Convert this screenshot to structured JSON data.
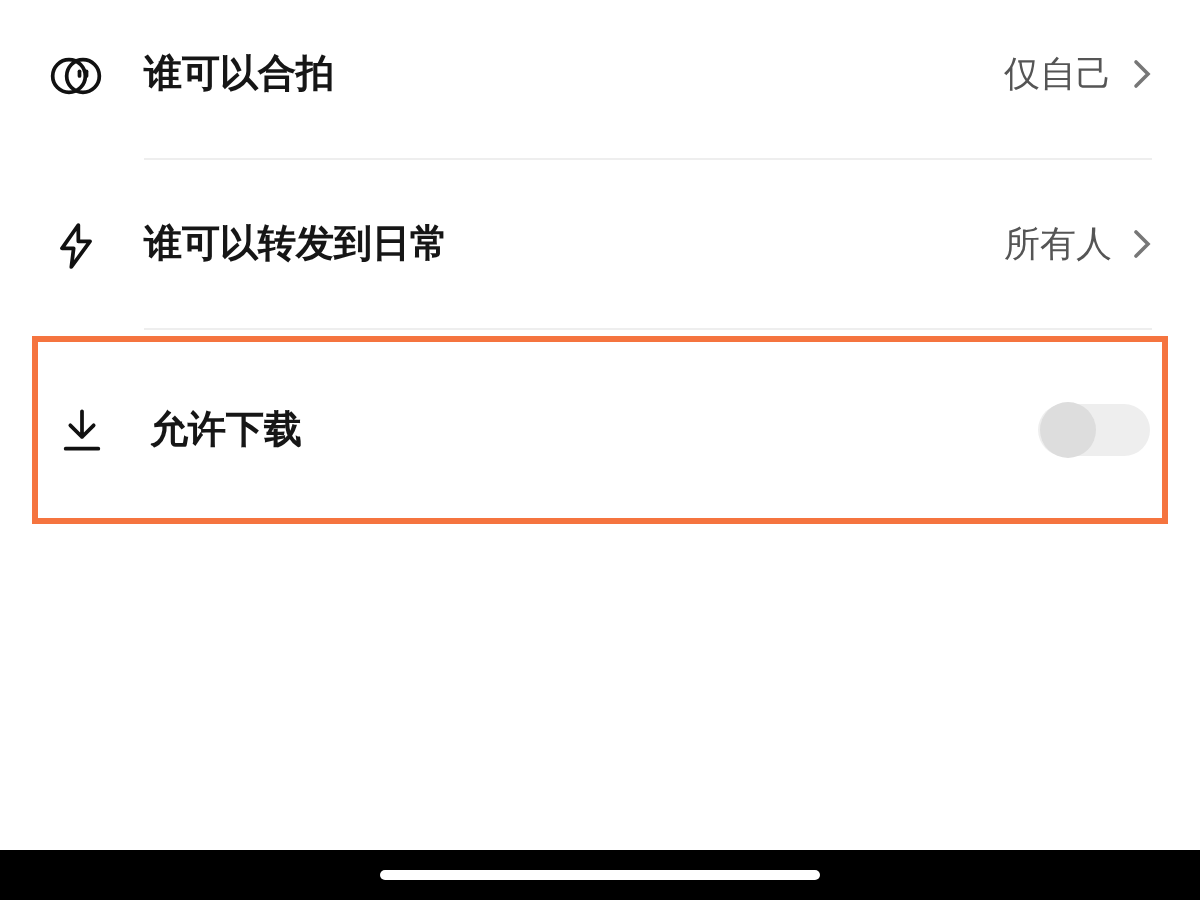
{
  "settings": [
    {
      "kind": "link",
      "label": "谁可以合拍",
      "value": "仅自己",
      "highlighted": false
    },
    {
      "kind": "link",
      "label": "谁可以转发到日常",
      "value": "所有人",
      "highlighted": false
    },
    {
      "kind": "toggle",
      "label": "允许下载",
      "on": false,
      "highlighted": true
    }
  ]
}
